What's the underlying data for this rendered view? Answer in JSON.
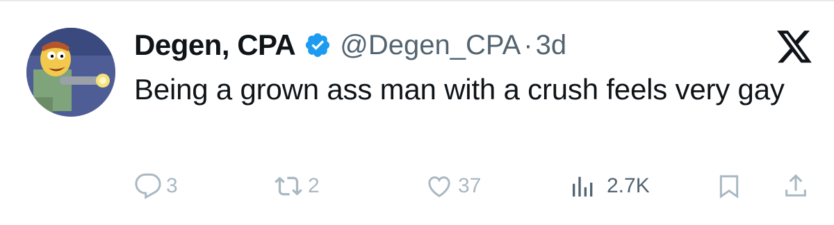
{
  "tweet": {
    "author": {
      "display_name": "Degen, CPA",
      "handle": "@Degen_CPA",
      "verified": true,
      "avatar": "cartoon-character-avatar"
    },
    "separator": "·",
    "time": "3d",
    "text": "Being a grown ass man with a crush feels very gay",
    "platform_icon": "x-logo-icon"
  },
  "actions": {
    "replies": {
      "icon": "reply-icon",
      "count": "3"
    },
    "reposts": {
      "icon": "repost-icon",
      "count": "2"
    },
    "likes": {
      "icon": "heart-icon",
      "count": "37"
    },
    "views": {
      "icon": "views-chart-icon",
      "count": "2.7K"
    },
    "bookmark": {
      "icon": "bookmark-icon"
    },
    "share": {
      "icon": "share-icon"
    }
  },
  "colors": {
    "text_primary": "#0f1419",
    "text_secondary": "#536471",
    "verified_blue": "#1d9bf0",
    "action_faded": "#aab8c2",
    "divider": "#e7e9ea"
  }
}
